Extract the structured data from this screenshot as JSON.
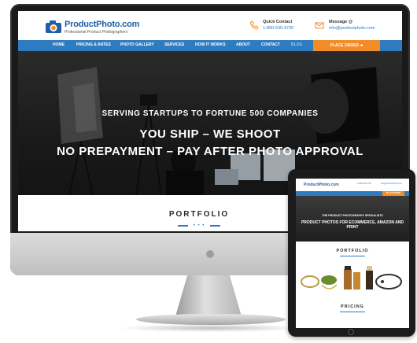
{
  "desktop_site": {
    "logo": {
      "name": "ProductPhoto.com",
      "tagline": "Professional Product Photographers"
    },
    "contact": {
      "phone_label": "Quick Contact",
      "phone": "1-800-530-3735",
      "email_label": "Message @",
      "email": "info@productphoto.com"
    },
    "nav": {
      "items": [
        "HOME",
        "PRICING & RATES",
        "PHOTO GALLERY",
        "SERVICES",
        "HOW IT WORKS",
        "ABOUT",
        "CONTACT",
        "BLOG"
      ],
      "cta": "PLACE ORDER"
    },
    "hero": {
      "line1": "SERVING STARTUPS TO FORTUNE 500 COMPANIES",
      "line2": "YOU SHIP – WE SHOOT",
      "line3": "NO PREPAYMENT – PAY AFTER PHOTO APPROVAL"
    },
    "section_heading": "PORTFOLIO",
    "section_dots": "• • •"
  },
  "tablet_site": {
    "logo": "ProductPhoto.com",
    "cta": "PLACE ORDER",
    "hero": {
      "line1": "THE PRODUCT PHOTOGRAPHY SPECIALISTS",
      "line2": "PRODUCT PHOTOS FOR ECOMMERCE, AMAZON AND PRINT"
    },
    "portfolio_heading": "PORTFOLIO",
    "pricing_heading": "PRICING"
  },
  "colors": {
    "brand_blue": "#2f7bc0",
    "cta_orange": "#f28c28",
    "logo_blue": "#1e5fa8"
  },
  "icons": [
    "monitor-apple-logo-icon",
    "phone-icon",
    "envelope-icon",
    "product-photo-logo-icon"
  ]
}
